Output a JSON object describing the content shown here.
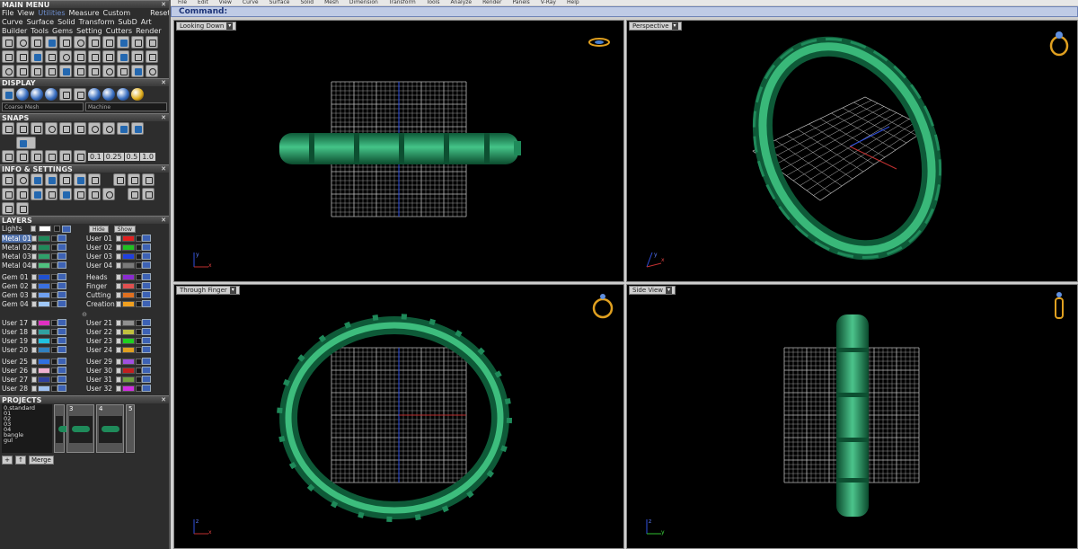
{
  "main_menu": {
    "title": "MAIN MENU",
    "menu": [
      "File",
      "View",
      "Utilities",
      "Measure",
      "Custom"
    ],
    "reset": "Reset",
    "row2": [
      "Curve",
      "Surface",
      "Solid",
      "Transform",
      "SubD",
      "Art"
    ],
    "row3": [
      "Builder",
      "Tools",
      "Gems",
      "Setting",
      "Cutters",
      "Render"
    ]
  },
  "display": {
    "title": "DISPLAY",
    "mesh_select": "Coarse Mesh",
    "material_select": "Machine"
  },
  "snaps": {
    "title": "SNAPS",
    "values": [
      "0.1",
      "0.25",
      "0.5",
      "1.0"
    ]
  },
  "info": {
    "title": "INFO & SETTINGS"
  },
  "layers": {
    "title": "LAYERS",
    "lights_label": "Lights",
    "hide_label": "Hide",
    "show_label": "Show",
    "group1_left": [
      {
        "name": "Metal 01",
        "color": "#1f8a5a",
        "highlight": true
      },
      {
        "name": "Metal 02",
        "color": "#1f8a5a"
      },
      {
        "name": "Metal 03",
        "color": "#2fa06a"
      },
      {
        "name": "Metal 04",
        "color": "#4fc07f"
      }
    ],
    "group1_right": [
      {
        "name": "User 01",
        "color": "#e02020"
      },
      {
        "name": "User 02",
        "color": "#20c020"
      },
      {
        "name": "User 03",
        "color": "#2040e0"
      },
      {
        "name": "User 04",
        "color": "#7a7a7a"
      }
    ],
    "group2_left": [
      {
        "name": "Gem 01",
        "color": "#2050d0"
      },
      {
        "name": "Gem 02",
        "color": "#3a70e0"
      },
      {
        "name": "Gem 03",
        "color": "#6fa0f0"
      },
      {
        "name": "Gem 04",
        "color": "#a0c8f8"
      }
    ],
    "group2_right": [
      {
        "name": "Heads",
        "color": "#8a2bd0"
      },
      {
        "name": "Finger",
        "color": "#e05050"
      },
      {
        "name": "Cutting",
        "color": "#e07020"
      },
      {
        "name": "Creation",
        "color": "#f0a020"
      }
    ],
    "group3_left": [
      {
        "name": "User 17",
        "color": "#e030c0"
      },
      {
        "name": "User 18",
        "color": "#30a0a0"
      },
      {
        "name": "User 19",
        "color": "#20c0e0"
      },
      {
        "name": "User 20",
        "color": "#3080c0"
      }
    ],
    "group3_right": [
      {
        "name": "User 21",
        "color": "#909090"
      },
      {
        "name": "User 22",
        "color": "#c0c040"
      },
      {
        "name": "User 23",
        "color": "#20d020"
      },
      {
        "name": "User 24",
        "color": "#e0a020"
      }
    ],
    "group4_left": [
      {
        "name": "User 25",
        "color": "#3070e0"
      },
      {
        "name": "User 26",
        "color": "#f0b0d0"
      },
      {
        "name": "User 27",
        "color": "#3040a0"
      },
      {
        "name": "User 28",
        "color": "#a0c0f0"
      }
    ],
    "group4_right": [
      {
        "name": "User 29",
        "color": "#a050e0"
      },
      {
        "name": "User 30",
        "color": "#c02020"
      },
      {
        "name": "User 31",
        "color": "#70a040"
      },
      {
        "name": "User 32",
        "color": "#d030e0"
      }
    ]
  },
  "projects": {
    "title": "PROJECTS",
    "list": [
      "0.standard",
      "01",
      "02",
      "03",
      "04",
      "bangle",
      "gul"
    ],
    "thumbs": [
      "3",
      "4",
      "5"
    ],
    "merge_label": "Merge"
  },
  "top_menu": [
    "File",
    "Edit",
    "View",
    "Curve",
    "Surface",
    "Solid",
    "Mesh",
    "Dimension",
    "Transform",
    "Tools",
    "Analyze",
    "Render",
    "Panels",
    "V-Ray",
    "Help"
  ],
  "command": {
    "label": "Command:"
  },
  "viewports": {
    "top_left": {
      "title": "Looking Down"
    },
    "top_right": {
      "title": "Perspective"
    },
    "bottom_left": {
      "title": "Through Finger"
    },
    "bottom_right": {
      "title": "Side View"
    }
  },
  "colors": {
    "ring": "#1f8a5a",
    "ring_highlight": "#52c88e",
    "grid": "#bdbdbd",
    "command_bg": "#bfcbe6"
  }
}
